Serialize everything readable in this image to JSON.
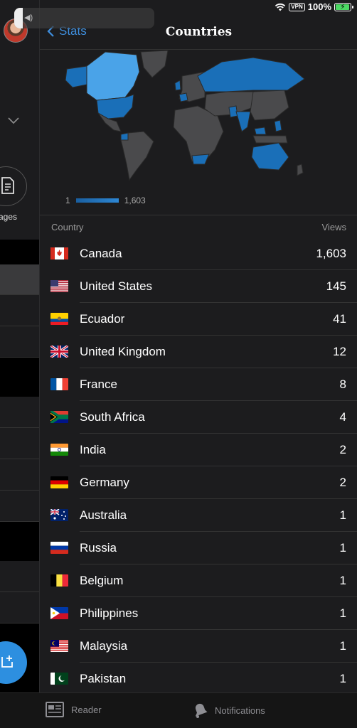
{
  "status_bar": {
    "vpn": "VPN",
    "battery": "100%",
    "battery_level": 1.0
  },
  "sidebar": {
    "pages_label": "ages"
  },
  "navbar": {
    "back_label": "Stats",
    "title": "Countries"
  },
  "map": {
    "legend_min": "1",
    "legend_max": "1,603"
  },
  "table": {
    "col_country": "Country",
    "col_views": "Views",
    "rows": [
      {
        "country": "Canada",
        "views": "1,603",
        "flag": "canada"
      },
      {
        "country": "United States",
        "views": "145",
        "flag": "usa"
      },
      {
        "country": "Ecuador",
        "views": "41",
        "flag": "ecuador"
      },
      {
        "country": "United Kingdom",
        "views": "12",
        "flag": "uk"
      },
      {
        "country": "France",
        "views": "8",
        "flag": "france"
      },
      {
        "country": "South Africa",
        "views": "4",
        "flag": "south-africa"
      },
      {
        "country": "India",
        "views": "2",
        "flag": "india"
      },
      {
        "country": "Germany",
        "views": "2",
        "flag": "germany"
      },
      {
        "country": "Australia",
        "views": "1",
        "flag": "australia"
      },
      {
        "country": "Russia",
        "views": "1",
        "flag": "russia"
      },
      {
        "country": "Belgium",
        "views": "1",
        "flag": "belgium"
      },
      {
        "country": "Philippines",
        "views": "1",
        "flag": "philippines"
      },
      {
        "country": "Malaysia",
        "views": "1",
        "flag": "malaysia"
      },
      {
        "country": "Pakistan",
        "views": "1",
        "flag": "pakistan"
      }
    ]
  },
  "tabbar": {
    "reader_label": "Reader",
    "notifications_label": "Notifications"
  },
  "colors": {
    "accent": "#3f8fde",
    "map_high": "#4aa3e8",
    "map_low": "#1a6fb8",
    "map_none": "#4a4a4c"
  }
}
